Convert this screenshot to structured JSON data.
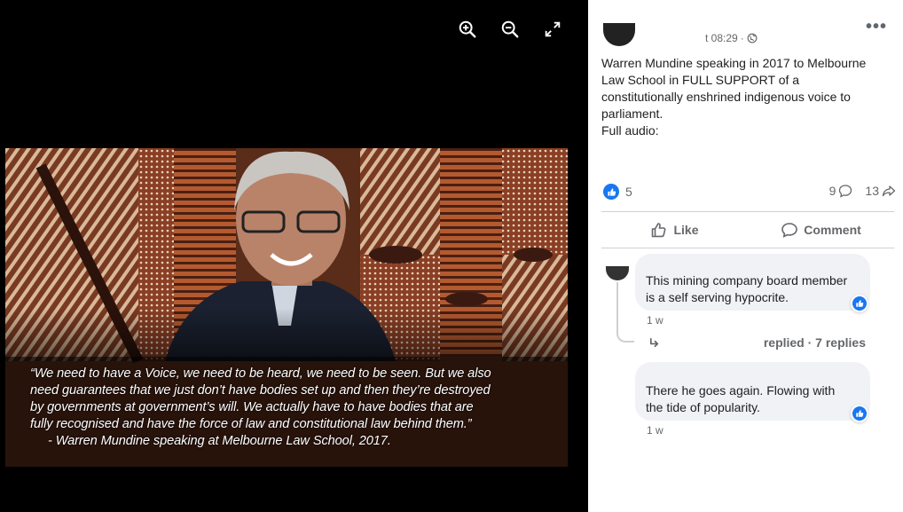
{
  "viewer": {
    "tools": [
      {
        "icon": "zoom-in-icon"
      },
      {
        "icon": "zoom-out-icon"
      },
      {
        "icon": "expand-icon"
      }
    ],
    "quote": {
      "lines": [
        "“We need to have a Voice, we need to be heard, we need to be seen. But we also",
        "need guarantees that we just don’t have bodies set up and then they’re destroyed",
        "by governments at government’s will. We actually have to have bodies that are",
        "fully recognised and have the force of law and constitutional law behind them.”"
      ],
      "attribution": "-  Warren Mundine speaking at Melbourne Law School, 2017."
    }
  },
  "post": {
    "more_label": "•••",
    "timestamp": "t 08:29",
    "separator": "·",
    "privacy_icon": "globe-icon",
    "text_lines": [
      "Warren Mundine speaking in 2017 to Melbourne",
      "Law School in FULL SUPPORT of a",
      "constitutionally enshrined indigenous voice to",
      "parliament.",
      "Full audio:"
    ],
    "reaction_count": "5",
    "comment_count": "9",
    "share_count": "13"
  },
  "actions": {
    "like": "Like",
    "comment": "Comment"
  },
  "comments": [
    {
      "text_lines": [
        "This mining company board member",
        "is a self serving hypocrite."
      ],
      "time": "1 w",
      "reaction": "like"
    },
    {
      "text_lines": [
        "There he goes again. Flowing with",
        "the tide of popularity."
      ],
      "time": "1 w",
      "reaction": "like"
    }
  ],
  "replies": {
    "label": "replied · 7 replies"
  },
  "colors": {
    "facebook_blue": "#1877f2",
    "bubble_bg": "#f0f2f5",
    "secondary_text": "#65676b"
  }
}
